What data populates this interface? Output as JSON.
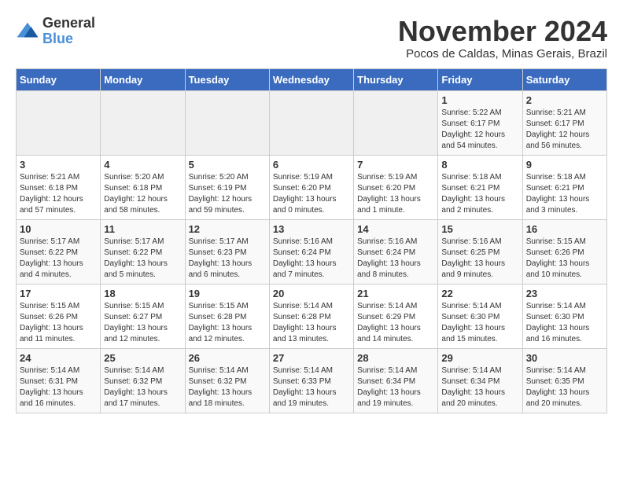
{
  "header": {
    "logo_general": "General",
    "logo_blue": "Blue",
    "month_title": "November 2024",
    "subtitle": "Pocos de Caldas, Minas Gerais, Brazil"
  },
  "days_of_week": [
    "Sunday",
    "Monday",
    "Tuesday",
    "Wednesday",
    "Thursday",
    "Friday",
    "Saturday"
  ],
  "weeks": [
    [
      {
        "day": "",
        "info": ""
      },
      {
        "day": "",
        "info": ""
      },
      {
        "day": "",
        "info": ""
      },
      {
        "day": "",
        "info": ""
      },
      {
        "day": "",
        "info": ""
      },
      {
        "day": "1",
        "info": "Sunrise: 5:22 AM\nSunset: 6:17 PM\nDaylight: 12 hours\nand 54 minutes."
      },
      {
        "day": "2",
        "info": "Sunrise: 5:21 AM\nSunset: 6:17 PM\nDaylight: 12 hours\nand 56 minutes."
      }
    ],
    [
      {
        "day": "3",
        "info": "Sunrise: 5:21 AM\nSunset: 6:18 PM\nDaylight: 12 hours\nand 57 minutes."
      },
      {
        "day": "4",
        "info": "Sunrise: 5:20 AM\nSunset: 6:18 PM\nDaylight: 12 hours\nand 58 minutes."
      },
      {
        "day": "5",
        "info": "Sunrise: 5:20 AM\nSunset: 6:19 PM\nDaylight: 12 hours\nand 59 minutes."
      },
      {
        "day": "6",
        "info": "Sunrise: 5:19 AM\nSunset: 6:20 PM\nDaylight: 13 hours\nand 0 minutes."
      },
      {
        "day": "7",
        "info": "Sunrise: 5:19 AM\nSunset: 6:20 PM\nDaylight: 13 hours\nand 1 minute."
      },
      {
        "day": "8",
        "info": "Sunrise: 5:18 AM\nSunset: 6:21 PM\nDaylight: 13 hours\nand 2 minutes."
      },
      {
        "day": "9",
        "info": "Sunrise: 5:18 AM\nSunset: 6:21 PM\nDaylight: 13 hours\nand 3 minutes."
      }
    ],
    [
      {
        "day": "10",
        "info": "Sunrise: 5:17 AM\nSunset: 6:22 PM\nDaylight: 13 hours\nand 4 minutes."
      },
      {
        "day": "11",
        "info": "Sunrise: 5:17 AM\nSunset: 6:22 PM\nDaylight: 13 hours\nand 5 minutes."
      },
      {
        "day": "12",
        "info": "Sunrise: 5:17 AM\nSunset: 6:23 PM\nDaylight: 13 hours\nand 6 minutes."
      },
      {
        "day": "13",
        "info": "Sunrise: 5:16 AM\nSunset: 6:24 PM\nDaylight: 13 hours\nand 7 minutes."
      },
      {
        "day": "14",
        "info": "Sunrise: 5:16 AM\nSunset: 6:24 PM\nDaylight: 13 hours\nand 8 minutes."
      },
      {
        "day": "15",
        "info": "Sunrise: 5:16 AM\nSunset: 6:25 PM\nDaylight: 13 hours\nand 9 minutes."
      },
      {
        "day": "16",
        "info": "Sunrise: 5:15 AM\nSunset: 6:26 PM\nDaylight: 13 hours\nand 10 minutes."
      }
    ],
    [
      {
        "day": "17",
        "info": "Sunrise: 5:15 AM\nSunset: 6:26 PM\nDaylight: 13 hours\nand 11 minutes."
      },
      {
        "day": "18",
        "info": "Sunrise: 5:15 AM\nSunset: 6:27 PM\nDaylight: 13 hours\nand 12 minutes."
      },
      {
        "day": "19",
        "info": "Sunrise: 5:15 AM\nSunset: 6:28 PM\nDaylight: 13 hours\nand 12 minutes."
      },
      {
        "day": "20",
        "info": "Sunrise: 5:14 AM\nSunset: 6:28 PM\nDaylight: 13 hours\nand 13 minutes."
      },
      {
        "day": "21",
        "info": "Sunrise: 5:14 AM\nSunset: 6:29 PM\nDaylight: 13 hours\nand 14 minutes."
      },
      {
        "day": "22",
        "info": "Sunrise: 5:14 AM\nSunset: 6:30 PM\nDaylight: 13 hours\nand 15 minutes."
      },
      {
        "day": "23",
        "info": "Sunrise: 5:14 AM\nSunset: 6:30 PM\nDaylight: 13 hours\nand 16 minutes."
      }
    ],
    [
      {
        "day": "24",
        "info": "Sunrise: 5:14 AM\nSunset: 6:31 PM\nDaylight: 13 hours\nand 16 minutes."
      },
      {
        "day": "25",
        "info": "Sunrise: 5:14 AM\nSunset: 6:32 PM\nDaylight: 13 hours\nand 17 minutes."
      },
      {
        "day": "26",
        "info": "Sunrise: 5:14 AM\nSunset: 6:32 PM\nDaylight: 13 hours\nand 18 minutes."
      },
      {
        "day": "27",
        "info": "Sunrise: 5:14 AM\nSunset: 6:33 PM\nDaylight: 13 hours\nand 19 minutes."
      },
      {
        "day": "28",
        "info": "Sunrise: 5:14 AM\nSunset: 6:34 PM\nDaylight: 13 hours\nand 19 minutes."
      },
      {
        "day": "29",
        "info": "Sunrise: 5:14 AM\nSunset: 6:34 PM\nDaylight: 13 hours\nand 20 minutes."
      },
      {
        "day": "30",
        "info": "Sunrise: 5:14 AM\nSunset: 6:35 PM\nDaylight: 13 hours\nand 20 minutes."
      }
    ]
  ]
}
